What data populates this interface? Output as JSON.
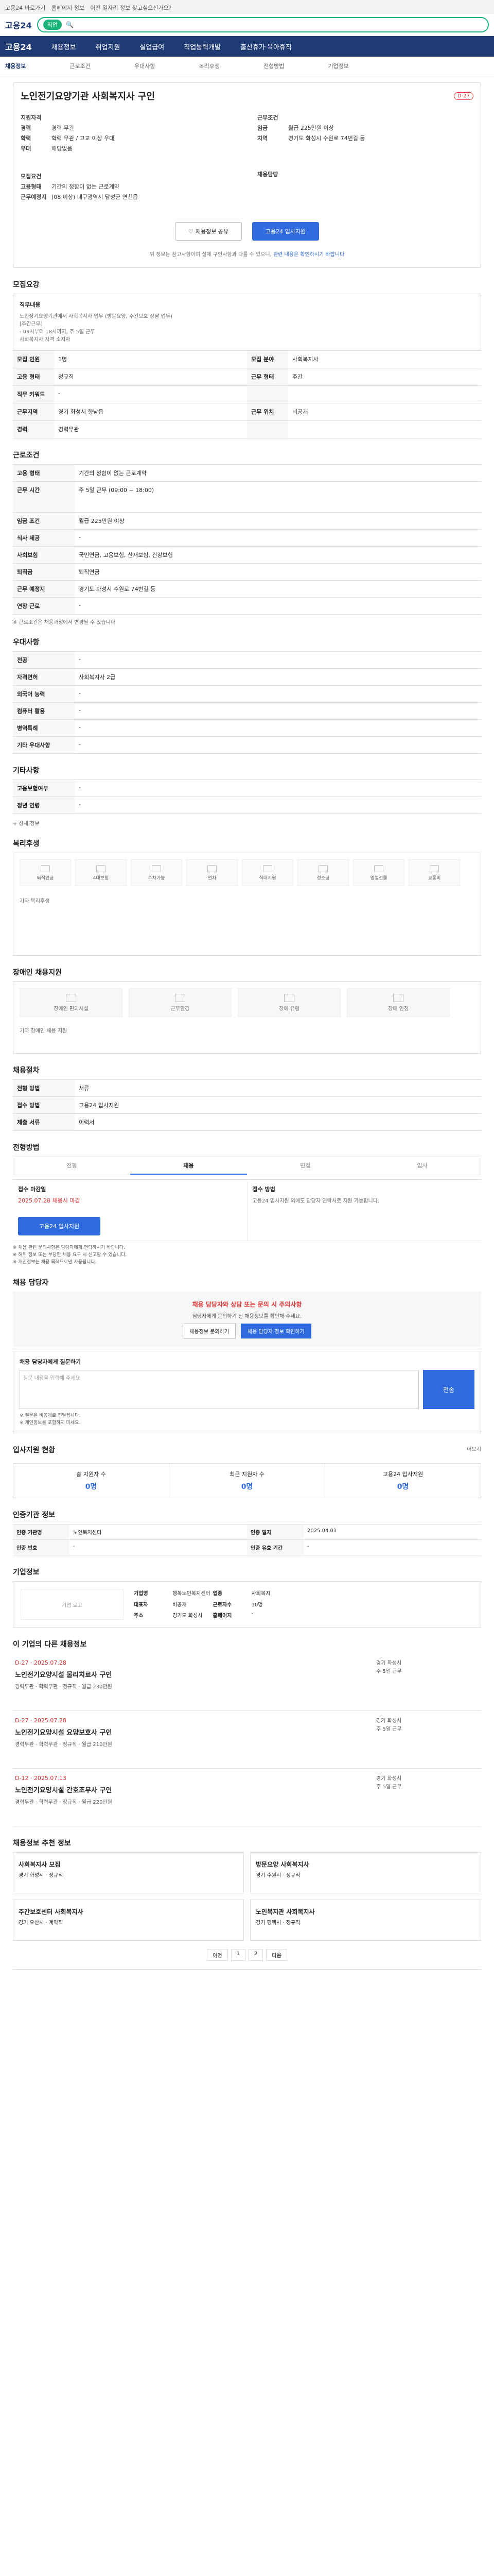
{
  "topbar": {
    "links": [
      "고용24 바로가기",
      "홈페이지 정보",
      "어떤 일자리 정보 찾고싶으신가요?"
    ]
  },
  "header": {
    "logo": "고용24",
    "search_pill": "직업",
    "search_placeholder": ""
  },
  "nav": {
    "brand": "고용24",
    "items": [
      "채용정보",
      "취업지원",
      "실업급여",
      "직업능력개발",
      "출산휴가·육아휴직"
    ]
  },
  "subnav": {
    "items": [
      "채용정보",
      "근로조건",
      "우대사항",
      "복리후생",
      "전형방법",
      "기업정보"
    ]
  },
  "job": {
    "title": "노인전기요양기관 사회복지사 구인",
    "dday": "D-27",
    "left": [
      {
        "k": "지원자격",
        "v": ""
      },
      {
        "k": "경력",
        "v": "경력 무관"
      },
      {
        "k": "학력",
        "v": "학력 무관 / 고교 이상 우대"
      },
      {
        "k": "우대",
        "v": "해당없음"
      },
      {
        "k": "",
        "v": ""
      },
      {
        "k": "모집요건",
        "v": ""
      },
      {
        "k": "고용형태",
        "v": "기간의 정함이 없는 근로계약"
      },
      {
        "k": "근무예정지",
        "v": "(08 이상) 대구광역시 달성군 연천읍"
      }
    ],
    "right": [
      {
        "k": "근무조건",
        "v": ""
      },
      {
        "k": "임금",
        "v": "월급 225만원 이상"
      },
      {
        "k": "지역",
        "v": "경기도 화성시 수원로 74번길 등"
      },
      {
        "k": "",
        "v": ""
      },
      {
        "k": "",
        "v": ""
      },
      {
        "k": "채용담당",
        "v": ""
      }
    ],
    "btn_share": "채용정보 공유",
    "btn_apply": "고용24 입사지원",
    "note_a": "위 정보는 참고사항이며 실제 구인사항과 다를 수 있으니,",
    "note_b": "관련 내용은 확인하시기 바랍니다"
  },
  "recruit": {
    "title": "모집요강",
    "desc_label": "직무내용",
    "desc": "노인장기요양기관에서 사회복지사 업무 (방문요양, 주간보호 상담 업무)\n[주간근무]\n- 09시부터 18시까지, 주 5일 근무\n사회복지사 자격 소지자",
    "rows": [
      [
        "모집 인원",
        "1명",
        "모집 분야",
        "사회복지사"
      ],
      [
        "고용 형태",
        "정규직",
        "근무 형태",
        "주간"
      ],
      [
        "직무 키워드",
        "-",
        "",
        ""
      ],
      [
        "근무지역",
        "경기 화성시 향남읍",
        "근무 위치",
        "비공개"
      ],
      [
        "경력",
        "경력무관",
        "",
        ""
      ]
    ]
  },
  "conditions": {
    "title": "근로조건",
    "rows": [
      [
        "고용 형태",
        "기간의 정함이 없는 근로계약"
      ],
      [
        "근무 시간",
        "주 5일 근무 (09:00 ~ 18:00)"
      ],
      [
        "임금 조건",
        "월급 225만원 이상"
      ],
      [
        "식사 제공",
        "-"
      ],
      [
        "사회보험",
        "국민연금, 고용보험, 산재보험, 건강보험"
      ],
      [
        "퇴직금",
        "퇴직연금"
      ],
      [
        "근무 예정지",
        "경기도 화성시 수원로 74번길 등"
      ],
      [
        "연장 근로",
        "-"
      ]
    ],
    "note": "※ 근로조건은 채용과정에서 변경될 수 있습니다"
  },
  "prefer": {
    "title": "우대사항",
    "rows": [
      [
        "전공",
        "-"
      ],
      [
        "자격면허",
        "사회복지사 2급"
      ],
      [
        "외국어 능력",
        "-"
      ],
      [
        "컴퓨터 활용",
        "-"
      ],
      [
        "병역특례",
        "-"
      ],
      [
        "기타 우대사항",
        "-"
      ]
    ]
  },
  "etc": {
    "title": "기타사항",
    "rows": [
      [
        "고용보험여부",
        "-"
      ],
      [
        "정년 연령",
        "-"
      ]
    ],
    "more": "+ 상세 정보"
  },
  "welfare": {
    "title": "복리후생",
    "items": [
      "퇴직연금",
      "4대보험",
      "주차가능",
      "연차",
      "식대지원",
      "경조금",
      "명절선물",
      "교통비"
    ],
    "more": "기타 복리후생"
  },
  "disability": {
    "title": "장애인 채용지원",
    "items": [
      "장애인 편의시설",
      "근무환경",
      "장애 유형",
      "장애 인정"
    ],
    "more": "기타 장애인 채용 지원"
  },
  "process": {
    "title": "채용절차",
    "rows": [
      [
        "전형 방법",
        "서류"
      ],
      [
        "접수 방법",
        "고용24 입사지원"
      ],
      [
        "제출 서류",
        "이력서"
      ]
    ]
  },
  "apply": {
    "title": "전형방법",
    "tabs": [
      "전형",
      "채용",
      "면접",
      "입사"
    ],
    "period_label": "접수 마감일",
    "period": "2025.07.28 채용시 마감",
    "right_label": "접수 방법",
    "right_text": "고용24 입사지원 외에도 담당자 연락처로 지원 가능합니다.",
    "btn": "고용24 입사지원",
    "bullets": [
      "※ 채용 관련 문의사항은 담당자에게 연락하시기 바랍니다.",
      "※ 허위 정보 또는 부당한 채용 요구 시 신고할 수 있습니다.",
      "※ 개인정보는 채용 목적으로만 사용됩니다."
    ]
  },
  "consult": {
    "title": "채용 담당자",
    "alert": "채용 담당자와 상담 또는 문의 시 주의사항",
    "p": "담당자에게 문의하기 전 채용정보를 확인해 주세요.",
    "b1": "채용정보 문의하기",
    "b2": "채용 담당자 정보 확인하기"
  },
  "inquiry": {
    "label": "채용 담당자에게 질문하기",
    "placeholder": "질문 내용을 입력해 주세요",
    "btn": "전송",
    "notes": [
      "※ 질문은 비공개로 전달됩니다.",
      "※ 개인정보를 포함하지 마세요."
    ]
  },
  "stats": {
    "title": "입사지원 현황",
    "more": "더보기",
    "items": [
      {
        "l": "총 지원자 수",
        "n": "0명"
      },
      {
        "l": "최근 지원자 수",
        "n": "0명"
      },
      {
        "l": "고용24 입사지원",
        "n": "0명"
      }
    ]
  },
  "org": {
    "title": "인증기관 정보",
    "rows": [
      [
        "인증 기관명",
        "노인복지센터",
        "인증 일자",
        "2025.04.01"
      ],
      [
        "인증 번호",
        "-",
        "인증 유효 기간",
        "-"
      ]
    ]
  },
  "company": {
    "title": "기업정보",
    "logo": "기업 로고",
    "rows": [
      [
        "기업명",
        "행복노인복지센터",
        "업종",
        "사회복지"
      ],
      [
        "대표자",
        "비공개",
        "근로자수",
        "10명"
      ],
      [
        "주소",
        "경기도 화성시",
        "홈페이지",
        "-"
      ]
    ]
  },
  "posts": {
    "title": "이 기업의 다른 채용정보",
    "items": [
      {
        "dd": "D-27 · 2025.07.28",
        "tt": "노인전기요양시설 물리치료사 구인",
        "meta": "경력무관 · 학력무관 · 정규직 · 월급 230만원",
        "right": "경기 화성시\n주 5일 근무"
      },
      {
        "dd": "D-27 · 2025.07.28",
        "tt": "노인전기요양시설 요양보호사 구인",
        "meta": "경력무관 · 학력무관 · 정규직 · 월급 210만원",
        "right": "경기 화성시\n주 5일 근무"
      },
      {
        "dd": "D-12 · 2025.07.13",
        "tt": "노인전기요양시설 간호조무사 구인",
        "meta": "경력무관 · 학력무관 · 정규직 · 월급 220만원",
        "right": "경기 화성시\n주 5일 근무"
      }
    ]
  },
  "recommend": {
    "title": "채용정보 추천 정보",
    "items": [
      {
        "tt": "사회복지사 모집",
        "sub": "경기 화성시 · 정규직"
      },
      {
        "tt": "방문요양 사회복지사",
        "sub": "경기 수원시 · 정규직"
      },
      {
        "tt": "주간보호센터 사회복지사",
        "sub": "경기 오산시 · 계약직"
      },
      {
        "tt": "노인복지관 사회복지사",
        "sub": "경기 평택시 · 정규직"
      }
    ]
  },
  "pager": [
    "이전",
    "1",
    "2",
    "다음"
  ]
}
